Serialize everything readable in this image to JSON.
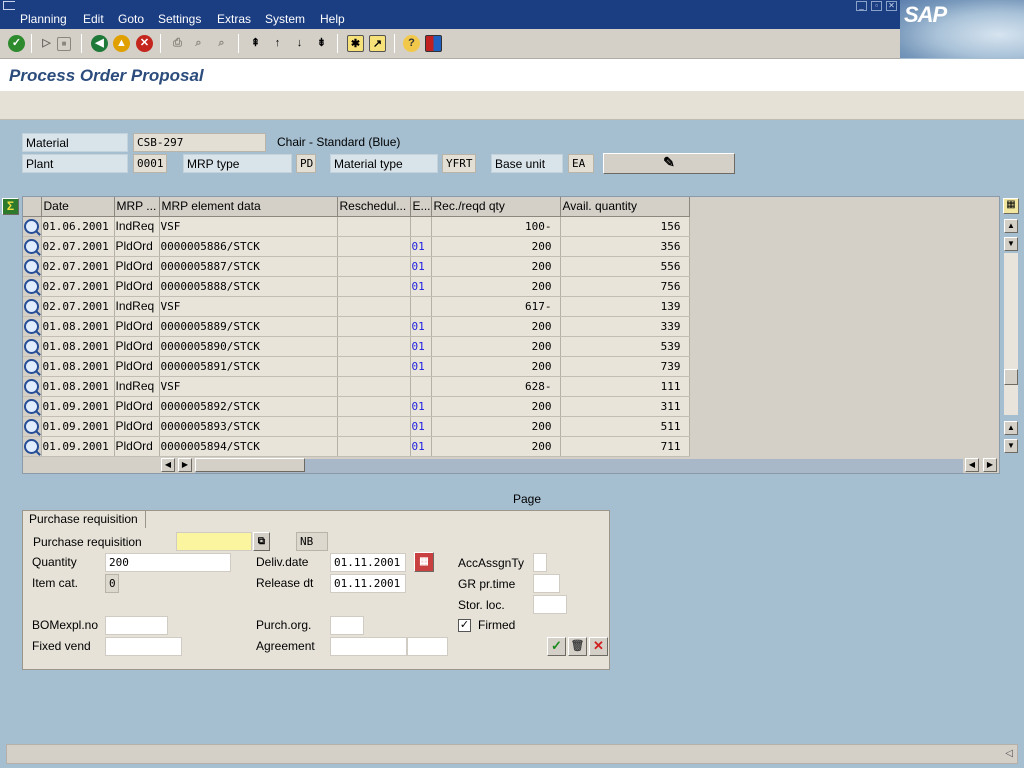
{
  "menu": {
    "items": [
      {
        "label": "Planning",
        "key": "P"
      },
      {
        "label": "Edit",
        "key": "E"
      },
      {
        "label": "Goto",
        "key": "G"
      },
      {
        "label": "Settings",
        "key": "S"
      },
      {
        "label": "Extras",
        "key": "x"
      },
      {
        "label": "System",
        "key": "y"
      },
      {
        "label": "Help",
        "key": "H"
      }
    ]
  },
  "logo": "SAP",
  "title": "Process Order Proposal",
  "header": {
    "material_label": "Material",
    "material_value": "CSB-297",
    "material_desc": "Chair - Standard (Blue)",
    "plant_label": "Plant",
    "plant_value": "0001",
    "mrp_type_label": "MRP type",
    "mrp_type_value": "PD",
    "material_type_label": "Material type",
    "material_type_value": "YFRT",
    "base_unit_label": "Base unit",
    "base_unit_value": "EA"
  },
  "table": {
    "columns": [
      "Date",
      "MRP ...",
      "MRP element data",
      "Reschedul...",
      "E...",
      "Rec./reqd qty",
      "Avail. quantity"
    ],
    "rows": [
      {
        "date": "01.06.2001",
        "mrp": "IndReq",
        "element": "VSF",
        "resched": "",
        "e": "",
        "qty": "100-",
        "avail": "156"
      },
      {
        "date": "02.07.2001",
        "mrp": "PldOrd",
        "element": "0000005886/STCK",
        "resched": "",
        "e": "01",
        "qty": "200",
        "avail": "356"
      },
      {
        "date": "02.07.2001",
        "mrp": "PldOrd",
        "element": "0000005887/STCK",
        "resched": "",
        "e": "01",
        "qty": "200",
        "avail": "556"
      },
      {
        "date": "02.07.2001",
        "mrp": "PldOrd",
        "element": "0000005888/STCK",
        "resched": "",
        "e": "01",
        "qty": "200",
        "avail": "756"
      },
      {
        "date": "02.07.2001",
        "mrp": "IndReq",
        "element": "VSF",
        "resched": "",
        "e": "",
        "qty": "617-",
        "avail": "139"
      },
      {
        "date": "01.08.2001",
        "mrp": "PldOrd",
        "element": "0000005889/STCK",
        "resched": "",
        "e": "01",
        "qty": "200",
        "avail": "339"
      },
      {
        "date": "01.08.2001",
        "mrp": "PldOrd",
        "element": "0000005890/STCK",
        "resched": "",
        "e": "01",
        "qty": "200",
        "avail": "539"
      },
      {
        "date": "01.08.2001",
        "mrp": "PldOrd",
        "element": "0000005891/STCK",
        "resched": "",
        "e": "01",
        "qty": "200",
        "avail": "739"
      },
      {
        "date": "01.08.2001",
        "mrp": "IndReq",
        "element": "VSF",
        "resched": "",
        "e": "",
        "qty": "628-",
        "avail": "111"
      },
      {
        "date": "01.09.2001",
        "mrp": "PldOrd",
        "element": "0000005892/STCK",
        "resched": "",
        "e": "01",
        "qty": "200",
        "avail": "311"
      },
      {
        "date": "01.09.2001",
        "mrp": "PldOrd",
        "element": "0000005893/STCK",
        "resched": "",
        "e": "01",
        "qty": "200",
        "avail": "511"
      },
      {
        "date": "01.09.2001",
        "mrp": "PldOrd",
        "element": "0000005894/STCK",
        "resched": "",
        "e": "01",
        "qty": "200",
        "avail": "711"
      }
    ]
  },
  "page_label": "Page",
  "pr": {
    "tab": "Purchase requisition",
    "purch_req_label": "Purchase requisition",
    "purch_req_value": "",
    "doc_type": "NB",
    "quantity_label": "Quantity",
    "quantity_value": "200",
    "item_cat_label": "Item cat.",
    "item_cat_value": "0",
    "deliv_date_label": "Deliv.date",
    "deliv_date_value": "01.11.2001",
    "release_label": "Release dt",
    "release_value": "01.11.2001",
    "acc_label": "AccAssgnTy",
    "gr_label": "GR pr.time",
    "stor_label": "Stor. loc.",
    "bom_label": "BOMexpl.no",
    "purch_org_label": "Purch.org.",
    "firmed_label": "Firmed",
    "firmed": true,
    "fixed_vend_label": "Fixed vend",
    "agreement_label": "Agreement"
  }
}
